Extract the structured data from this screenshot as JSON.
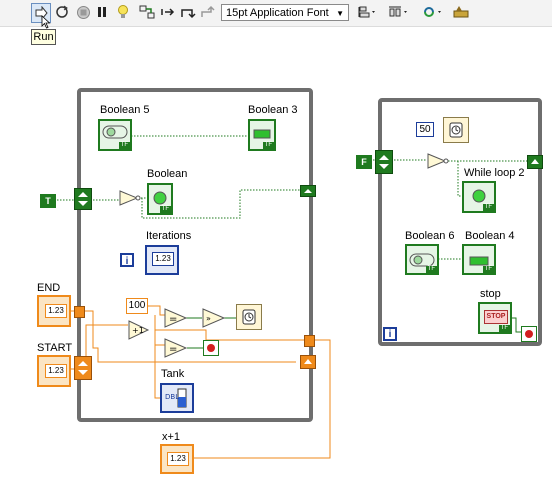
{
  "toolbar": {
    "font_select": "15pt Application Font",
    "tooltip": "Run"
  },
  "diagram": {
    "loop1": {
      "labels": {
        "boolean5": "Boolean 5",
        "boolean3": "Boolean 3",
        "boolean": "Boolean",
        "iterations": "Iterations",
        "tank": "Tank",
        "iter_terminal": "i"
      },
      "const_100": "100",
      "true_const": "T"
    },
    "outside": {
      "end_label": "END",
      "start_label": "START",
      "xplus1_label": "x+1",
      "num_text": "1.23"
    },
    "loop2": {
      "labels": {
        "while_loop2": "While loop 2",
        "boolean6": "Boolean 6",
        "boolean4": "Boolean 4",
        "stop": "stop",
        "iter_terminal": "i"
      },
      "const_50": "50",
      "false_const": "F",
      "stop_text": "STOP"
    }
  },
  "colors": {
    "boolean": "#1f7a1f",
    "numeric_dbl": "#ef8a1b",
    "numeric_int": "#1c3d9a",
    "loop_frame": "#6e6e6e"
  }
}
